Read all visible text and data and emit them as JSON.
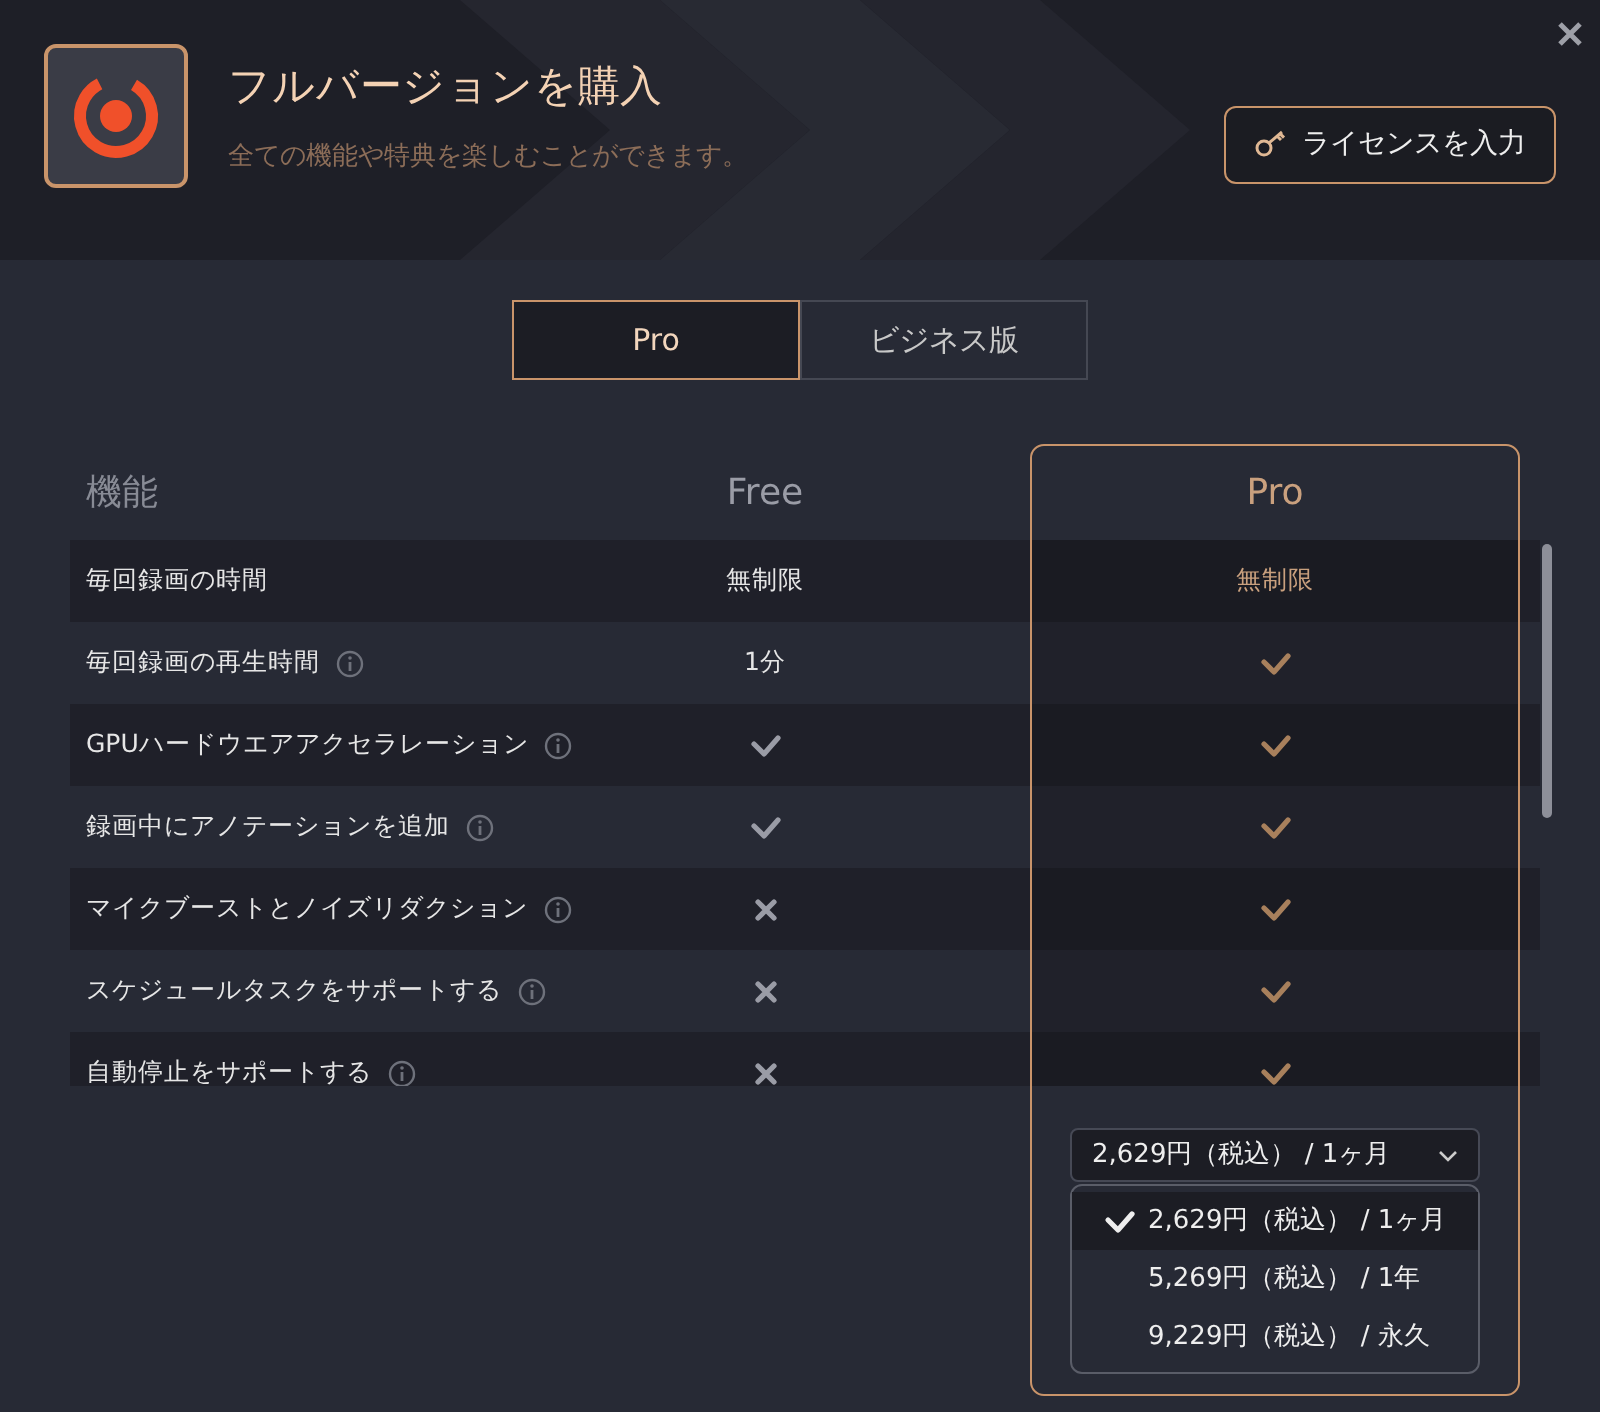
{
  "header": {
    "title": "フルバージョンを購入",
    "subtitle": "全ての機能や特典を楽しむことができます。",
    "license_button": "ライセンスを入力"
  },
  "plan_tabs": [
    {
      "label": "Pro",
      "selected": true
    },
    {
      "label": "ビジネス版",
      "selected": false
    }
  ],
  "table": {
    "columns": [
      "機能",
      "Free",
      "Pro"
    ],
    "rows": [
      {
        "feature": "毎回録画の時間",
        "info": false,
        "free": {
          "kind": "text",
          "text": "無制限"
        },
        "pro": {
          "kind": "text",
          "text": "無制限"
        }
      },
      {
        "feature": "毎回録画の再生時間",
        "info": true,
        "free": {
          "kind": "text",
          "text": "1分"
        },
        "pro": {
          "kind": "check"
        }
      },
      {
        "feature": "GPUハードウエアアクセラレーション",
        "info": true,
        "free": {
          "kind": "check"
        },
        "pro": {
          "kind": "check"
        }
      },
      {
        "feature": "録画中にアノテーションを追加",
        "info": true,
        "free": {
          "kind": "check"
        },
        "pro": {
          "kind": "check"
        }
      },
      {
        "feature": "マイクブーストとノイズリダクション",
        "info": true,
        "free": {
          "kind": "cross"
        },
        "pro": {
          "kind": "check"
        }
      },
      {
        "feature": "スケジュールタスクをサポートする",
        "info": true,
        "free": {
          "kind": "cross"
        },
        "pro": {
          "kind": "check"
        }
      },
      {
        "feature": "自動停止をサポートする",
        "info": true,
        "free": {
          "kind": "cross"
        },
        "pro": {
          "kind": "check"
        }
      }
    ]
  },
  "price_select": {
    "value": "2,629円（税込） / 1ヶ月",
    "expanded": true,
    "options": [
      {
        "label": "2,629円（税込） / 1ヶ月",
        "selected": true
      },
      {
        "label": "5,269円（税込） / 1年",
        "selected": false
      },
      {
        "label": "9,229円（税込） / 永久",
        "selected": false
      }
    ]
  }
}
